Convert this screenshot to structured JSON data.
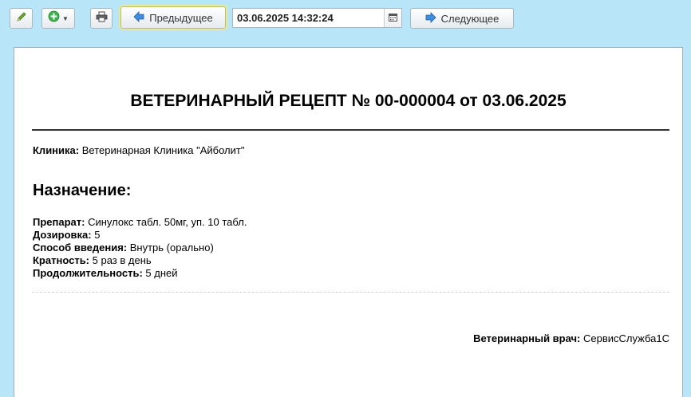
{
  "toolbar": {
    "prev_label": "Предыдущее",
    "next_label": "Следующее",
    "date_value": "03.06.2025 14:32:24"
  },
  "document": {
    "title": "ВЕТЕРИНАРНЫЙ РЕЦЕПТ № 00-000004 от 03.06.2025",
    "clinic_label": "Клиника:",
    "clinic_value": "Ветеринарная Клиника \"Айболит\"",
    "section_heading": "Назначение:",
    "fields": [
      {
        "label": "Препарат:",
        "value": "Синулокс табл. 50мг, уп. 10 табл."
      },
      {
        "label": "Дозировка:",
        "value": "5"
      },
      {
        "label": "Способ введения:",
        "value": "Внутрь (орально)"
      },
      {
        "label": "Кратность:",
        "value": "5 раз в день"
      },
      {
        "label": "Продолжительность:",
        "value": "5 дней"
      }
    ],
    "doctor_label": "Ветеринарный врач:",
    "doctor_value": "СервисСлужба1С"
  },
  "colors": {
    "background": "#b9e5f9",
    "accent_arrow": "#3f8ee0",
    "add_icon": "#3bb24a"
  }
}
